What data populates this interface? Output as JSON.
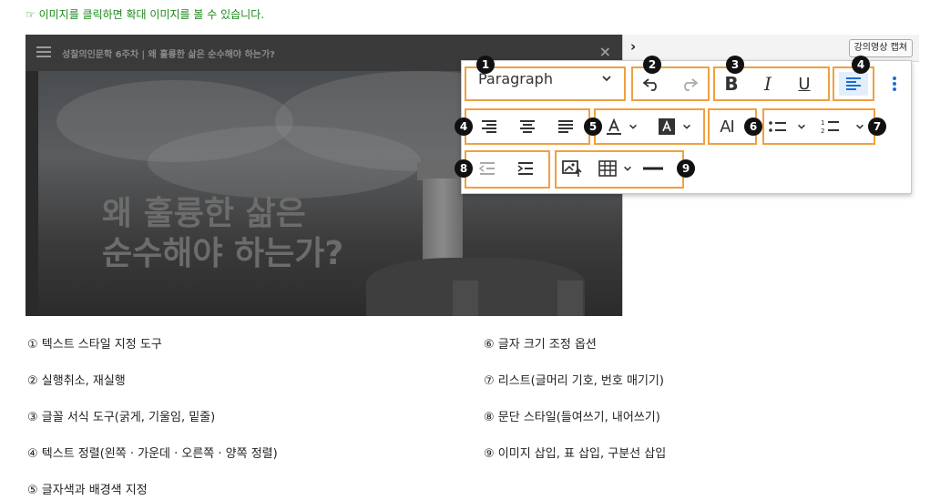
{
  "hint": "☞ 이미지를 클릭하면 확대 이미지를 볼 수 있습니다.",
  "player": {
    "title": "성찰의인문학 6주차 | 왜 훌륭한 삶은 순수해야 하는가?",
    "close": "×",
    "headline_line1": "왜 훌륭한 삶은",
    "headline_line2": "순수해야 하는가?"
  },
  "panel": {
    "arrow": "›",
    "capture_button": "강의영상 캡쳐"
  },
  "toolbar": {
    "paragraph_label": "Paragraph",
    "italic_label": "I",
    "bold_label": "B",
    "underline_label": "U",
    "font_size_label": "AI",
    "markers": [
      "1",
      "2",
      "3",
      "4",
      "4",
      "5",
      "6",
      "7",
      "8",
      "9"
    ],
    "highlight_color": "#f0a040",
    "active_color": "#1a6fd0"
  },
  "legend": {
    "left": [
      "① 텍스트 스타일 지정 도구",
      "② 실행취소, 재실행",
      "③ 글꼴 서식 도구(굵게, 기울임, 밑줄)",
      "④ 텍스트 정렬(왼쪽 · 가운데 · 오른쪽 · 양쪽 정렬)",
      "⑤ 글자색과 배경색 지정"
    ],
    "right": [
      "⑥ 글자 크기 조정 옵션",
      "⑦ 리스트(글머리 기호, 번호 매기기)",
      "⑧ 문단 스타일(들여쓰기, 내어쓰기)",
      "⑨ 이미지 삽입, 표 삽입, 구분선 삽입"
    ]
  }
}
